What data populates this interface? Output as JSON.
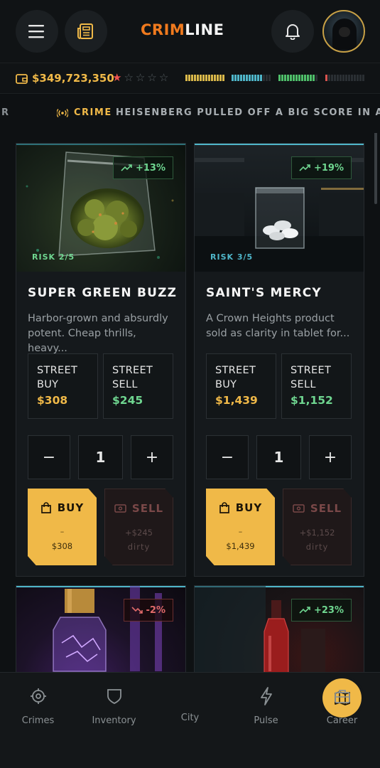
{
  "app": {
    "logo_part1": "CRIM",
    "logo_part2": "LINE"
  },
  "status": {
    "money": "$349,723,350",
    "wanted_stars_filled": 1,
    "wanted_stars_total": 5,
    "meters": [
      {
        "name": "energy",
        "color": "#d9b84a",
        "fill": 1.0
      },
      {
        "name": "focus",
        "color": "#4fb6c9",
        "fill": 0.75
      },
      {
        "name": "health",
        "color": "#4fbf6a",
        "fill": 0.95
      },
      {
        "name": "heat",
        "color": "#d9534f",
        "fill": 0.05
      }
    ]
  },
  "ticker": {
    "tail": "R",
    "tag": "CRIME",
    "message": "HEISENBERG PULLED OFF A BIG SCORE IN ASH HA"
  },
  "cards": [
    {
      "name": "SUPER GREEN BUZZ",
      "trend": "+13%",
      "risk": "RISK 2/5",
      "description_line1": "Harbor-grown and absurdly",
      "description_line2": "potent. Cheap thrills, heavy...",
      "buy_label_1": "STREET",
      "buy_label_2": "BUY",
      "buy_price": "$308",
      "sell_label_1": "STREET",
      "sell_label_2": "SELL",
      "sell_price": "$245",
      "quantity": "1",
      "buy_button": "BUY",
      "buy_button_dash": "–",
      "buy_button_total": "$308",
      "sell_button": "SELL",
      "sell_button_amount": "+$245",
      "sell_button_note": "dirty"
    },
    {
      "name": "SAINT'S MERCY",
      "trend": "+19%",
      "risk": "RISK 3/5",
      "description_line1": "A Crown Heights product",
      "description_line2": "sold as clarity in tablet for...",
      "buy_label_1": "STREET",
      "buy_label_2": "BUY",
      "buy_price": "$1,439",
      "sell_label_1": "STREET",
      "sell_label_2": "SELL",
      "sell_price": "$1,152",
      "quantity": "1",
      "buy_button": "BUY",
      "buy_button_dash": "–",
      "buy_button_total": "$1,439",
      "sell_button": "SELL",
      "sell_button_amount": "+$1,152",
      "sell_button_note": "dirty"
    },
    {
      "trend": "-2%"
    },
    {
      "trend": "+23%"
    }
  ],
  "controls": {
    "minus": "−",
    "plus": "+"
  },
  "nav": {
    "crimes": "Crimes",
    "inventory": "Inventory",
    "city": "City",
    "pulse": "Pulse",
    "career": "Career"
  },
  "colors": {
    "accent": "#f0b948",
    "brand_orange": "#f07a1e",
    "positive": "#6fd690",
    "negative": "#e06a6a",
    "risk_low": "#6fd690",
    "risk_mid": "#4fb6c9"
  }
}
